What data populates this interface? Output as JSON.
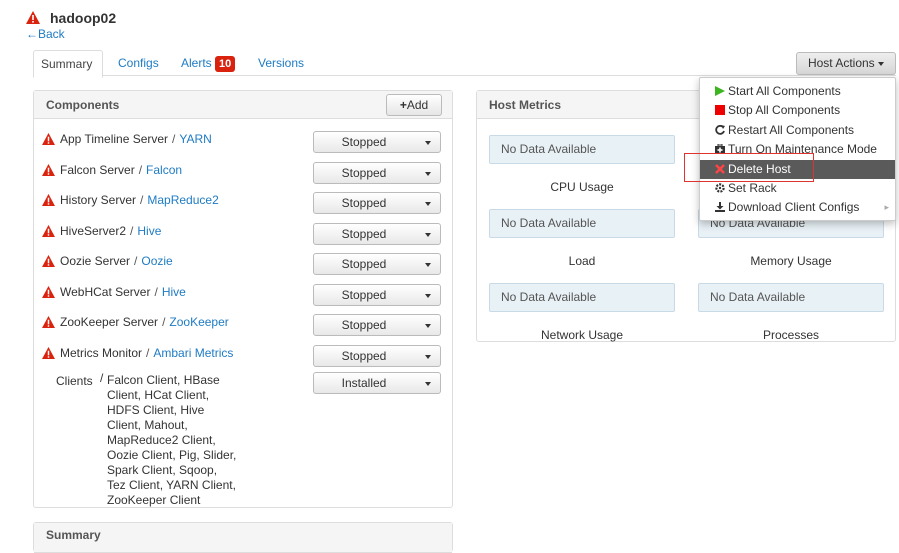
{
  "host": {
    "name": "hadoop02",
    "back": "Back"
  },
  "tabs": {
    "summary": "Summary",
    "configs": "Configs",
    "alerts": "Alerts",
    "alerts_count": "10",
    "versions": "Versions"
  },
  "host_actions": "Host Actions",
  "components": {
    "title": "Components",
    "add": "Add",
    "rows": [
      {
        "name": "App Timeline Server",
        "service": "YARN",
        "status": "Stopped"
      },
      {
        "name": "Falcon Server",
        "service": "Falcon",
        "status": "Stopped"
      },
      {
        "name": "History Server",
        "service": "MapReduce2",
        "status": "Stopped"
      },
      {
        "name": "HiveServer2",
        "service": "Hive",
        "status": "Stopped"
      },
      {
        "name": "Oozie Server",
        "service": "Oozie",
        "status": "Stopped"
      },
      {
        "name": "WebHCat Server",
        "service": "Hive",
        "status": "Stopped"
      },
      {
        "name": "ZooKeeper Server",
        "service": "ZooKeeper",
        "status": "Stopped"
      },
      {
        "name": "Metrics Monitor",
        "service": "Ambari Metrics",
        "status": "Stopped"
      }
    ],
    "clients_label": "Clients",
    "clients_lines": [
      "Falcon Client, HBase",
      "Client, HCat Client,",
      "HDFS Client, Hive",
      "Client, Mahout,",
      "MapReduce2 Client,",
      "Oozie Client, Pig, Slider,",
      "Spark Client, Sqoop,",
      "Tez Client, YARN Client,",
      "ZooKeeper Client"
    ],
    "clients_status": "Installed"
  },
  "summary_panel_title": "Summary",
  "metrics": {
    "title": "Host Metrics",
    "no_data": "No Data Available",
    "labels": [
      "CPU Usage",
      "Load",
      "Memory Usage",
      "Network Usage",
      "Processes"
    ]
  },
  "menu": {
    "items": [
      "Start All Components",
      "Stop All Components",
      "Restart All Components",
      "Turn On Maintenance Mode",
      "Delete Host",
      "Set Rack",
      "Download Client Configs"
    ]
  },
  "colors": {
    "link": "#1e7bc4",
    "alert": "#d9230f",
    "start": "#3cb521",
    "highlight": "#5a5a5a"
  }
}
